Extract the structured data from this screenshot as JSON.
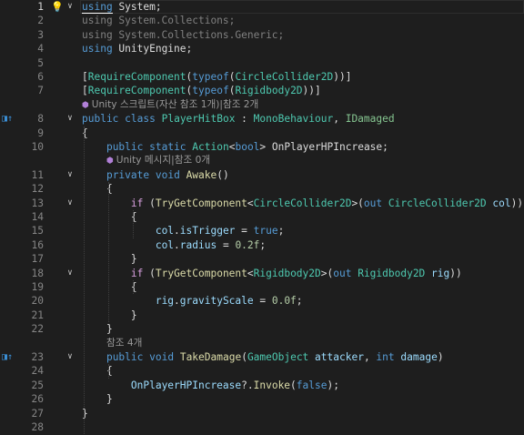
{
  "editor": {
    "current_line_label": "1",
    "lines": [
      {
        "n": "1",
        "code": [
          {
            "t": "using",
            "c": "k"
          },
          {
            "t": " ",
            "c": "p"
          },
          {
            "t": "System",
            "c": "p"
          },
          {
            "t": ";",
            "c": "p"
          }
        ]
      },
      {
        "n": "2",
        "code": [
          {
            "t": "using System.Collections;",
            "c": "u"
          }
        ]
      },
      {
        "n": "3",
        "code": [
          {
            "t": "using System.Collections.Generic;",
            "c": "u"
          }
        ]
      },
      {
        "n": "4",
        "code": [
          {
            "t": "using",
            "c": "k"
          },
          {
            "t": " UnityEngine;",
            "c": "p"
          }
        ]
      },
      {
        "n": "5",
        "code": []
      },
      {
        "n": "6",
        "code": [
          {
            "t": "[",
            "c": "p"
          },
          {
            "t": "RequireComponent",
            "c": "t"
          },
          {
            "t": "(",
            "c": "p"
          },
          {
            "t": "typeof",
            "c": "k"
          },
          {
            "t": "(",
            "c": "p"
          },
          {
            "t": "CircleCollider2D",
            "c": "t"
          },
          {
            "t": "))]",
            "c": "p"
          }
        ]
      },
      {
        "n": "7",
        "code": [
          {
            "t": "[",
            "c": "p"
          },
          {
            "t": "RequireComponent",
            "c": "t"
          },
          {
            "t": "(",
            "c": "p"
          },
          {
            "t": "typeof",
            "c": "k"
          },
          {
            "t": "(",
            "c": "p"
          },
          {
            "t": "Rigidbody2D",
            "c": "t"
          },
          {
            "t": "))]",
            "c": "p"
          }
        ]
      },
      {
        "lens": "Unity 스크립트(자산 참조 1개)|참조 2개",
        "lens_icon": "⬢"
      },
      {
        "n": "8",
        "code": [
          {
            "t": "public",
            "c": "k"
          },
          {
            "t": " ",
            "c": "p"
          },
          {
            "t": "class",
            "c": "k"
          },
          {
            "t": " ",
            "c": "p"
          },
          {
            "t": "PlayerHitBox",
            "c": "t"
          },
          {
            "t": " : ",
            "c": "p"
          },
          {
            "t": "MonoBehaviour",
            "c": "t"
          },
          {
            "t": ", ",
            "c": "p"
          },
          {
            "t": "IDamaged",
            "c": "tm"
          }
        ]
      },
      {
        "n": "9",
        "code": [
          {
            "t": "{",
            "c": "p"
          }
        ]
      },
      {
        "n": "10",
        "code": [
          {
            "t": "    "
          },
          {
            "t": "public",
            "c": "k"
          },
          {
            "t": " ",
            "c": "p"
          },
          {
            "t": "static",
            "c": "k"
          },
          {
            "t": " ",
            "c": "p"
          },
          {
            "t": "Action",
            "c": "t"
          },
          {
            "t": "<",
            "c": "p"
          },
          {
            "t": "bool",
            "c": "k"
          },
          {
            "t": "> ",
            "c": "p"
          },
          {
            "t": "OnPlayerHPIncrease",
            "c": "p"
          },
          {
            "t": ";",
            "c": "p"
          }
        ]
      },
      {
        "lens": "Unity 메시지|참조 0개",
        "lens_icon": "⬢",
        "indent": "    "
      },
      {
        "n": "11",
        "code": [
          {
            "t": "    "
          },
          {
            "t": "private",
            "c": "k"
          },
          {
            "t": " ",
            "c": "p"
          },
          {
            "t": "void",
            "c": "k"
          },
          {
            "t": " ",
            "c": "p"
          },
          {
            "t": "Awake",
            "c": "m"
          },
          {
            "t": "()",
            "c": "p"
          }
        ]
      },
      {
        "n": "12",
        "code": [
          {
            "t": "    "
          },
          {
            "t": "{",
            "c": "p"
          }
        ]
      },
      {
        "n": "13",
        "code": [
          {
            "t": "        "
          },
          {
            "t": "if",
            "c": "kc"
          },
          {
            "t": " (",
            "c": "p"
          },
          {
            "t": "TryGetComponent",
            "c": "m"
          },
          {
            "t": "<",
            "c": "p"
          },
          {
            "t": "CircleCollider2D",
            "c": "t"
          },
          {
            "t": ">(",
            "c": "p"
          },
          {
            "t": "out",
            "c": "k"
          },
          {
            "t": " ",
            "c": "p"
          },
          {
            "t": "CircleCollider2D",
            "c": "t"
          },
          {
            "t": " ",
            "c": "p"
          },
          {
            "t": "col",
            "c": "v"
          },
          {
            "t": "))",
            "c": "p"
          }
        ]
      },
      {
        "n": "14",
        "code": [
          {
            "t": "        "
          },
          {
            "t": "{",
            "c": "p"
          }
        ]
      },
      {
        "n": "15",
        "code": [
          {
            "t": "            "
          },
          {
            "t": "col",
            "c": "v"
          },
          {
            "t": ".",
            "c": "p"
          },
          {
            "t": "isTrigger",
            "c": "v"
          },
          {
            "t": " = ",
            "c": "p"
          },
          {
            "t": "true",
            "c": "k"
          },
          {
            "t": ";",
            "c": "p"
          }
        ]
      },
      {
        "n": "16",
        "code": [
          {
            "t": "            "
          },
          {
            "t": "col",
            "c": "v"
          },
          {
            "t": ".",
            "c": "p"
          },
          {
            "t": "radius",
            "c": "v"
          },
          {
            "t": " = ",
            "c": "p"
          },
          {
            "t": "0.2f",
            "c": "n"
          },
          {
            "t": ";",
            "c": "p"
          }
        ]
      },
      {
        "n": "17",
        "code": [
          {
            "t": "        "
          },
          {
            "t": "}",
            "c": "p"
          }
        ]
      },
      {
        "n": "18",
        "code": [
          {
            "t": "        "
          },
          {
            "t": "if",
            "c": "kc"
          },
          {
            "t": " (",
            "c": "p"
          },
          {
            "t": "TryGetComponent",
            "c": "m"
          },
          {
            "t": "<",
            "c": "p"
          },
          {
            "t": "Rigidbody2D",
            "c": "t"
          },
          {
            "t": ">(",
            "c": "p"
          },
          {
            "t": "out",
            "c": "k"
          },
          {
            "t": " ",
            "c": "p"
          },
          {
            "t": "Rigidbody2D",
            "c": "t"
          },
          {
            "t": " ",
            "c": "p"
          },
          {
            "t": "rig",
            "c": "v"
          },
          {
            "t": "))",
            "c": "p"
          }
        ]
      },
      {
        "n": "19",
        "code": [
          {
            "t": "        "
          },
          {
            "t": "{",
            "c": "p"
          }
        ]
      },
      {
        "n": "20",
        "code": [
          {
            "t": "            "
          },
          {
            "t": "rig",
            "c": "v"
          },
          {
            "t": ".",
            "c": "p"
          },
          {
            "t": "gravityScale",
            "c": "v"
          },
          {
            "t": " = ",
            "c": "p"
          },
          {
            "t": "0.0f",
            "c": "n"
          },
          {
            "t": ";",
            "c": "p"
          }
        ]
      },
      {
        "n": "21",
        "code": [
          {
            "t": "        "
          },
          {
            "t": "}",
            "c": "p"
          }
        ]
      },
      {
        "n": "22",
        "code": [
          {
            "t": "    "
          },
          {
            "t": "}",
            "c": "p"
          }
        ]
      },
      {
        "lens": "참조 4개",
        "indent": "    "
      },
      {
        "n": "23",
        "code": [
          {
            "t": "    "
          },
          {
            "t": "public",
            "c": "k"
          },
          {
            "t": " ",
            "c": "p"
          },
          {
            "t": "void",
            "c": "k"
          },
          {
            "t": " ",
            "c": "p"
          },
          {
            "t": "TakeDamage",
            "c": "m"
          },
          {
            "t": "(",
            "c": "p"
          },
          {
            "t": "GameObject",
            "c": "t"
          },
          {
            "t": " ",
            "c": "p"
          },
          {
            "t": "attacker",
            "c": "v"
          },
          {
            "t": ", ",
            "c": "p"
          },
          {
            "t": "int",
            "c": "k"
          },
          {
            "t": " ",
            "c": "p"
          },
          {
            "t": "damage",
            "c": "v"
          },
          {
            "t": ")",
            "c": "p"
          }
        ]
      },
      {
        "n": "24",
        "code": [
          {
            "t": "    "
          },
          {
            "t": "{",
            "c": "p"
          }
        ]
      },
      {
        "n": "25",
        "code": [
          {
            "t": "        "
          },
          {
            "t": "OnPlayerHPIncrease",
            "c": "v"
          },
          {
            "t": "?.",
            "c": "p"
          },
          {
            "t": "Invoke",
            "c": "m"
          },
          {
            "t": "(",
            "c": "p"
          },
          {
            "t": "false",
            "c": "k"
          },
          {
            "t": ");",
            "c": "p"
          }
        ]
      },
      {
        "n": "26",
        "code": [
          {
            "t": "    "
          },
          {
            "t": "}",
            "c": "p"
          }
        ]
      },
      {
        "n": "27",
        "code": [
          {
            "t": "}",
            "c": "p"
          }
        ]
      },
      {
        "n": "28",
        "code": []
      }
    ],
    "folds": [
      "1",
      "8",
      "11",
      "13",
      "18",
      "23"
    ],
    "gutter_icons": [
      {
        "line": "1",
        "icon": "lightbulb-icon",
        "glyph": "💡"
      },
      {
        "line": "8",
        "icon": "implementation-icon",
        "glyph": "◨↑"
      },
      {
        "line": "23",
        "icon": "implementation-icon",
        "glyph": "◨↑"
      }
    ],
    "fold_glyph": "∨",
    "colors": {
      "background": "#1e1e1e",
      "keyword": "#569cd6",
      "control": "#d8a0df",
      "type": "#4ec9b0",
      "method": "#dcdcaa",
      "variable": "#9cdcfe",
      "number": "#b5cea8",
      "unused": "#808080"
    }
  }
}
